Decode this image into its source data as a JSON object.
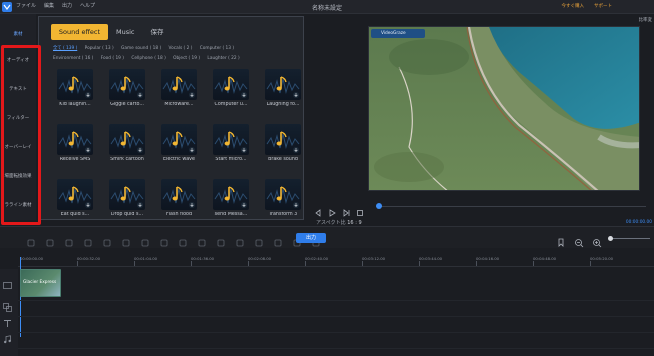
{
  "titlebar": {
    "menu": [
      "ファイル",
      "編集",
      "出力",
      "ヘルプ"
    ],
    "title": "名称未設定",
    "buy": "今すぐ購入",
    "support": "サポート"
  },
  "nav": {
    "items": [
      "素材",
      "オーディオ",
      "テキスト",
      "フィルター",
      "オーバーレイ",
      "場面転換効果",
      "ラライン素材"
    ]
  },
  "library": {
    "tabs": [
      "Sound effect",
      "Music",
      "保存"
    ],
    "filters": [
      "全て ( 139 )",
      "Popular ( 13 )",
      "Game sound ( 18 )",
      "Vocals ( 2 )",
      "Computer ( 13 )",
      "Environment ( 16 )",
      "Food ( 19 )",
      "Cellphone ( 18 )",
      "Object ( 19 )",
      "Laughter ( 22 )"
    ],
    "items": [
      "Kid laughin...",
      "Giggle carto...",
      "Microware...",
      "Computer u...",
      "Laughing fo...",
      "Receive SMS",
      "Smirk cartoon",
      "Electric wave",
      "Start micro...",
      "Brake sound",
      "Eat quid s...",
      "Drop quid s...",
      "Flash flood",
      "send Messa...",
      "Transform 3"
    ]
  },
  "preview": {
    "aspect_label_top": "比率変",
    "watermark": "VideoGraze",
    "aspect_label": "アスペクト比",
    "aspect_value": "16 : 9",
    "time": "00:00:00.00"
  },
  "toolbar": {
    "export_label": "出力"
  },
  "timeline": {
    "ticks": [
      "00:00:00.00",
      "00:00:32.00",
      "00:01:04.00",
      "00:01:36.00",
      "00:02:08.00",
      "00:02:40.00",
      "00:03:12.00",
      "00:03:44.00",
      "00:04:16.00",
      "00:04:48.00",
      "00:05:20.00"
    ],
    "clip_label": "Glacier Express"
  },
  "colors": {
    "accent": "#2f7dea",
    "tab_active": "#f2b632",
    "highlight_frame": "#e3181a"
  }
}
